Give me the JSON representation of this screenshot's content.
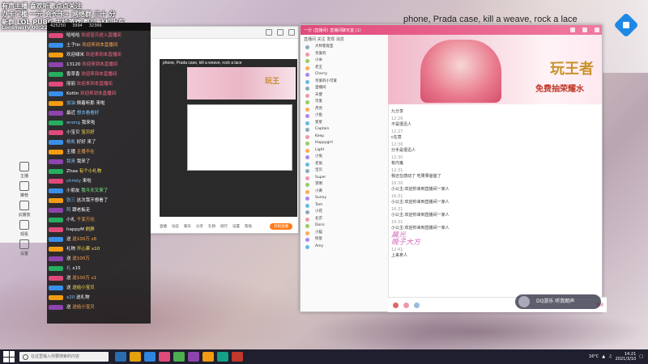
{
  "overlay": {
    "line1": "有声主播 喜欢听歌点点关注",
    "line2": "办卡门槛 一元 会长卡+ 网络群 三十 分",
    "line3": "新群 LOL PUBG 主机游戏 都可 飞机上车",
    "line4": "Lordmerry 00:22"
  },
  "background_phrase": "phone, Prada case, kill a weave, rock a lace",
  "sidebar_app": {
    "items": [
      {
        "label": "主播"
      },
      {
        "label": "推荐"
      },
      {
        "label": "云播放"
      },
      {
        "label": "观看"
      },
      {
        "label": "设置"
      }
    ]
  },
  "chat": {
    "stats": [
      "425250",
      "3994",
      "32366"
    ],
    "messages": [
      {
        "name": "哈哈哈",
        "text": "欢迎宝贝进入直播间",
        "color": "pink"
      },
      {
        "name": "土子lin",
        "text": "欢迎来到本直播间",
        "color": "orange"
      },
      {
        "name": "欢迎绿米",
        "text": "欢迎来到本直播间",
        "color": "pink"
      },
      {
        "name": "13120",
        "text": "欢迎来到本直播间",
        "color": "pink"
      },
      {
        "name": "香草香",
        "text": "欢迎来到本直播间",
        "color": "pink"
      },
      {
        "name": "丽丽",
        "text": "欢迎来到本直播间",
        "color": "pink"
      },
      {
        "name": "Kotlin",
        "text": "欢迎来到本直播间",
        "color": "pink"
      },
      {
        "name": "加油",
        "text": "倒着听那 来啦",
        "color": "white"
      },
      {
        "name": "最近",
        "text": "想去看看好",
        "color": "blue"
      },
      {
        "name": "wrong",
        "text": "我来啦",
        "color": "white"
      },
      {
        "name": "小宝贝",
        "text": "宝贝好",
        "color": "yellow"
      },
      {
        "name": "杨凯",
        "text": "好好 来了",
        "color": "white"
      },
      {
        "name": "主播",
        "text": "主播不在",
        "color": "orange"
      },
      {
        "name": "我来",
        "text": "我来了",
        "color": "white"
      },
      {
        "name": "Zhaa",
        "text": "有个小礼物",
        "color": "yellow"
      },
      {
        "name": "chrisly",
        "text": "来啦",
        "color": "white"
      },
      {
        "name": "小朋友",
        "text": "我今天又来了",
        "color": "green"
      },
      {
        "name": "张三",
        "text": "这次我不想看了",
        "color": "white"
      },
      {
        "name": "阿",
        "text": "跟老板走",
        "color": "white"
      },
      {
        "name": "小礼",
        "text": "千变万化",
        "color": "orange"
      },
      {
        "name": "happyM",
        "text": "刷屏",
        "color": "yellow"
      },
      {
        "name": "送",
        "text": "送100万 x6",
        "color": "orange"
      },
      {
        "name": "礼物",
        "text": "开心果 x10",
        "color": "yellow"
      },
      {
        "name": "送",
        "text": "送100万",
        "color": "orange"
      },
      {
        "name": "礼",
        "text": "x15",
        "color": "white"
      },
      {
        "name": "送",
        "text": "送100万 x1",
        "color": "orange"
      },
      {
        "name": "送",
        "text": "送给小宝贝",
        "color": "yellow"
      },
      {
        "name": "x20",
        "text": "送礼物",
        "color": "white"
      },
      {
        "name": "送",
        "text": "送给小宝贝",
        "color": "orange"
      }
    ]
  },
  "mid_window": {
    "phrase": "phone, Prada case, kill a weave, rock a lace",
    "banner_text": "玩王",
    "toolbar": [
      "直播",
      "动态",
      "聊天",
      "分享",
      "礼物",
      "排行",
      "设置",
      "帮助"
    ],
    "live_button": "开始直播"
  },
  "right_window": {
    "title": "一分 (直播间) 直播间聊天室 (1)",
    "banner_title": "玩王者",
    "banner_sub": "免费抽荣耀水",
    "room_header": [
      "直播间",
      "关注",
      "发现",
      "消息"
    ],
    "rooms": [
      "大师客观室",
      "亲爱的",
      "小米",
      "老王",
      "Cherry",
      "亲爱的小可爱",
      "直播间",
      "天使",
      "可爱",
      "月亮",
      "小鱼",
      "星星",
      "Captain",
      "Keep",
      "Happygirl",
      "Light",
      "小兔",
      "老张",
      "宝贝",
      "Super",
      "李明",
      "小黄",
      "Sunny",
      "Tom",
      "小花",
      "北京",
      "Doris",
      "小猫",
      "阿星",
      "Amy"
    ],
    "messages": [
      {
        "text": "九分享",
        "meta": "",
        "big": false
      },
      {
        "text": "不是很迅人",
        "meta": "12:26",
        "big": false
      },
      {
        "text": "c在意",
        "meta": "12:27",
        "big": false
      },
      {
        "text": "分手是很迅人",
        "meta": "12:30",
        "big": false
      },
      {
        "text": "有内鬼",
        "meta": "12:30",
        "big": false
      },
      {
        "text": "我还在感动了 吃果果爸爸了",
        "meta": "12:31",
        "big": false
      },
      {
        "text": "小公主:欢迎你来到直播间一家人",
        "meta": "16:30",
        "big": false
      },
      {
        "text": "小公主:欢迎你来到直播间一家人",
        "meta": "16:31",
        "big": false
      },
      {
        "text": "小公主:欢迎你来到直播间一家人",
        "meta": "16:31",
        "big": false
      },
      {
        "text": "小公主:欢迎你来到直播间一家人",
        "meta": "16:31",
        "big": false
      },
      {
        "text": "晨光",
        "meta": "",
        "big": true
      },
      {
        "text": "晚子大方",
        "meta": "",
        "big": true
      },
      {
        "text": "上来拿人",
        "meta": "12:41",
        "big": false
      }
    ],
    "send_label": "发送"
  },
  "dq_badge": {
    "label": "DQ游乐 听我朗声"
  },
  "taskbar": {
    "search_placeholder": "在这里输入你要搜索的内容",
    "weather": "16°C",
    "time": "14:21",
    "date": "2021/3/10"
  }
}
